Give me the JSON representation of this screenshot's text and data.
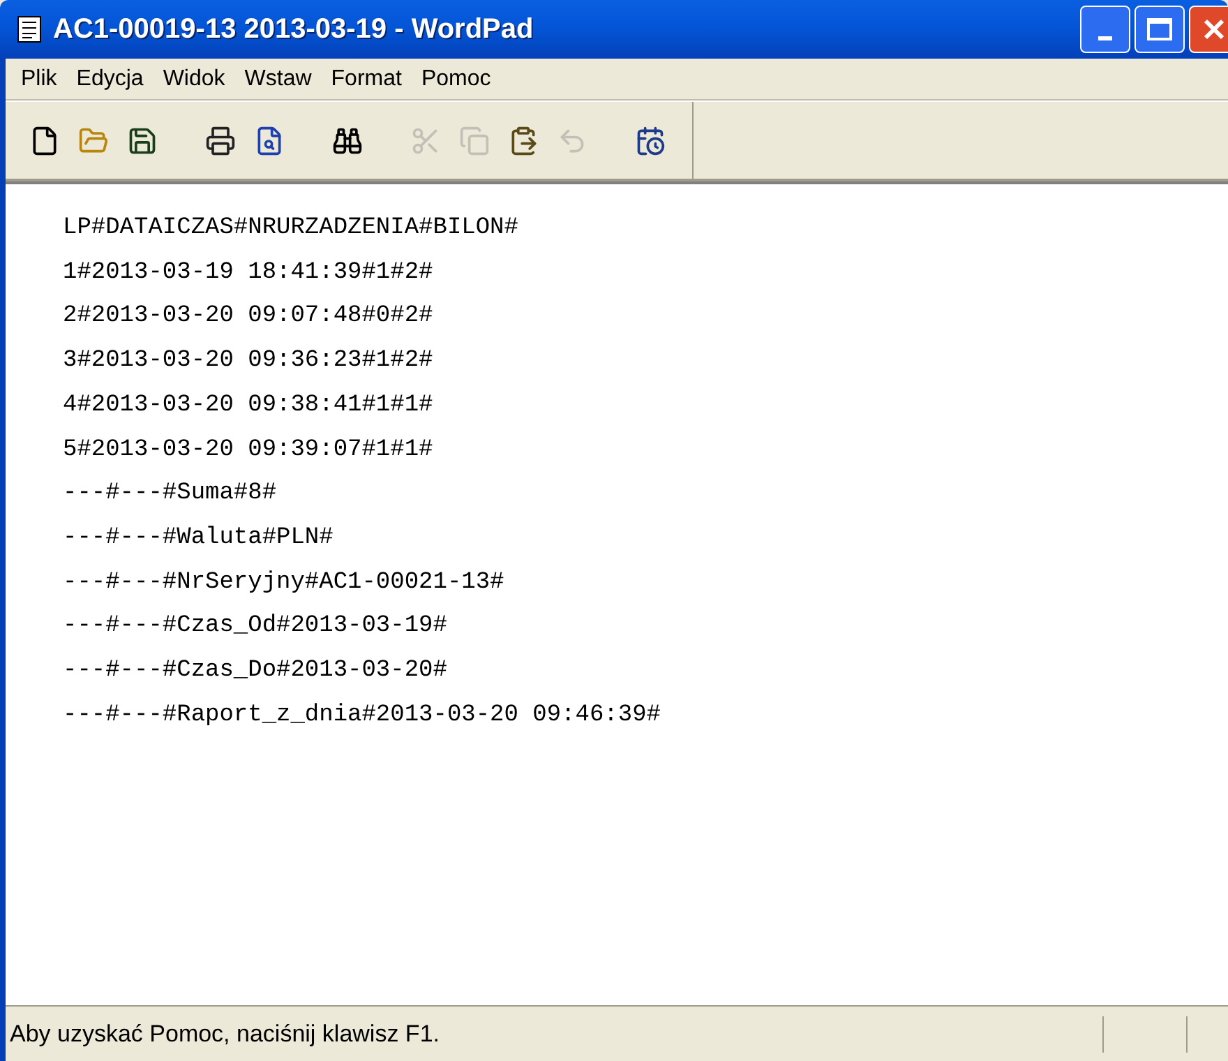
{
  "window": {
    "title": "AC1-00019-13 2013-03-19 - WordPad"
  },
  "menu": [
    "Plik",
    "Edycja",
    "Widok",
    "Wstaw",
    "Format",
    "Pomoc"
  ],
  "toolbar": [
    {
      "kind": "new",
      "disabled": false
    },
    {
      "kind": "open",
      "disabled": false
    },
    {
      "kind": "save",
      "disabled": false
    },
    {
      "kind": "sep"
    },
    {
      "kind": "print",
      "disabled": false
    },
    {
      "kind": "preview",
      "disabled": false
    },
    {
      "kind": "sep"
    },
    {
      "kind": "find",
      "disabled": false
    },
    {
      "kind": "sep"
    },
    {
      "kind": "cut",
      "disabled": true
    },
    {
      "kind": "copy",
      "disabled": true
    },
    {
      "kind": "paste",
      "disabled": false
    },
    {
      "kind": "undo",
      "disabled": true
    },
    {
      "kind": "sep"
    },
    {
      "kind": "datetime",
      "disabled": false
    }
  ],
  "document": {
    "lines": [
      "LP#DATAICZAS#NRURZADZENIA#BILON#",
      "1#2013-03-19 18:41:39#1#2#",
      "2#2013-03-20 09:07:48#0#2#",
      "3#2013-03-20 09:36:23#1#2#",
      "4#2013-03-20 09:38:41#1#1#",
      "5#2013-03-20 09:39:07#1#1#",
      "---#---#Suma#8#",
      "---#---#Waluta#PLN#",
      "---#---#NrSeryjny#AC1-00021-13#",
      "---#---#Czas_Od#2013-03-19#",
      "---#---#Czas_Do#2013-03-20#",
      "---#---#Raport_z_dnia#2013-03-20 09:46:39#"
    ]
  },
  "status_bar": {
    "text": "Aby uzyskać Pomoc, naciśnij klawisz F1."
  }
}
